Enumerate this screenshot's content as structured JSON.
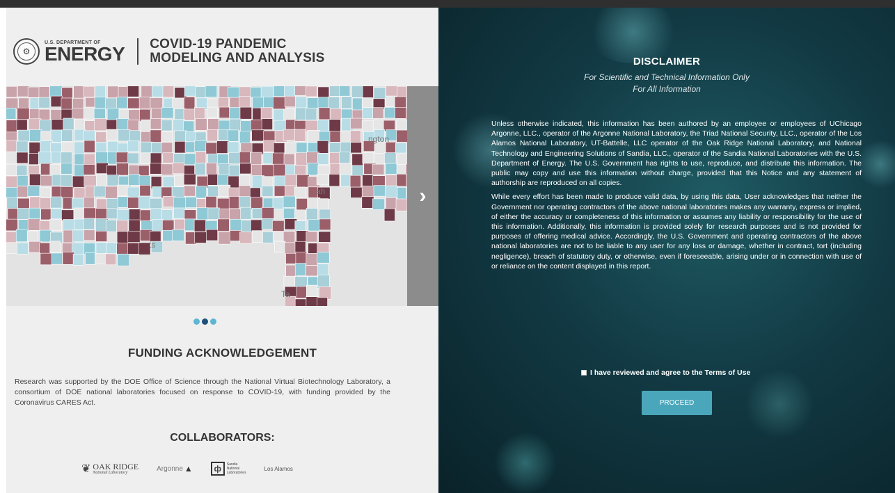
{
  "header": {
    "doe_small": "U.S. DEPARTMENT OF",
    "doe_big": "ENERGY",
    "title_line1": "COVID-19 PANDEMIC",
    "title_line2": "MODELING AND ANALYSIS"
  },
  "map": {
    "label_arrow": "›",
    "visible_labels": [
      "ngton",
      "ah",
      "ts",
      "Ta"
    ]
  },
  "carousel": {
    "slides": 3,
    "active_index": 1
  },
  "funding": {
    "title": "FUNDING ACKNOWLEDGEMENT",
    "text": "Research was supported by the DOE Office of Science through the National Virtual Biotechnology Laboratory, a consortium of DOE national laboratories focused on response to COVID-19, with funding provided by the Coronavirus CARES Act."
  },
  "collaborators": {
    "title": "COLLABORATORS:",
    "oak_ridge_1": "OAK RIDGE",
    "oak_ridge_2": "National Laboratory",
    "argonne": "Argonne",
    "sandia_1": "Sandia",
    "sandia_2": "National",
    "sandia_3": "Laboratories",
    "los_alamos": "Los Alamos"
  },
  "disclaimer": {
    "title": "DISCLAIMER",
    "subtitle1": "For Scientific and Technical Information Only",
    "subtitle2": "For All Information",
    "para1": "Unless otherwise indicated, this information has been authored by an employee or employees of UChicago Argonne, LLC., operator of the Argonne National Laboratory, the Triad National Security, LLC., operator of the Los Alamos National Laboratory, UT-Battelle, LLC operator of the Oak Ridge National Laboratory, and National Technology and Engineering Solutions of Sandia, LLC., operator of the Sandia National Laboratories with the U.S. Department of Energy. The U.S. Government has rights to use, reproduce, and distribute this information. The public may copy and use this information without charge, provided that this Notice and any statement of authorship are reproduced on all copies.",
    "para2": "While every effort has been made to produce valid data, by using this data, User acknowledges that neither the Government nor operating contractors of the above national laboratories makes any warranty, express or implied, of either the accuracy or completeness of this information or assumes any liability or responsibility for the use of this information. Additionally, this information is provided solely for research purposes and is not provided for purposes of offering medical advice. Accordingly, the U.S. Government and operating contractors of the above national laboratories are not to be liable to any user for any loss or damage, whether in contract, tort (including negligence), breach of statutory duty, or otherwise, even if foreseeable, arising under or in connection with use of or reliance on the content displayed in this report.",
    "agree_label": "I have reviewed and agree to the Terms of Use",
    "agree_checked": false,
    "proceed_label": "PROCEED"
  },
  "colors": {
    "accent": "#4aa7bb",
    "dot_active": "#1f4f7a",
    "dot_inactive": "#5bb7d3",
    "map_palette": [
      "#8fc9d6",
      "#b8dde6",
      "#e6e6e6",
      "#c9a3aa",
      "#9b5f6a",
      "#6e3a47",
      "#d8b8bd",
      "#a9cfd8"
    ]
  }
}
